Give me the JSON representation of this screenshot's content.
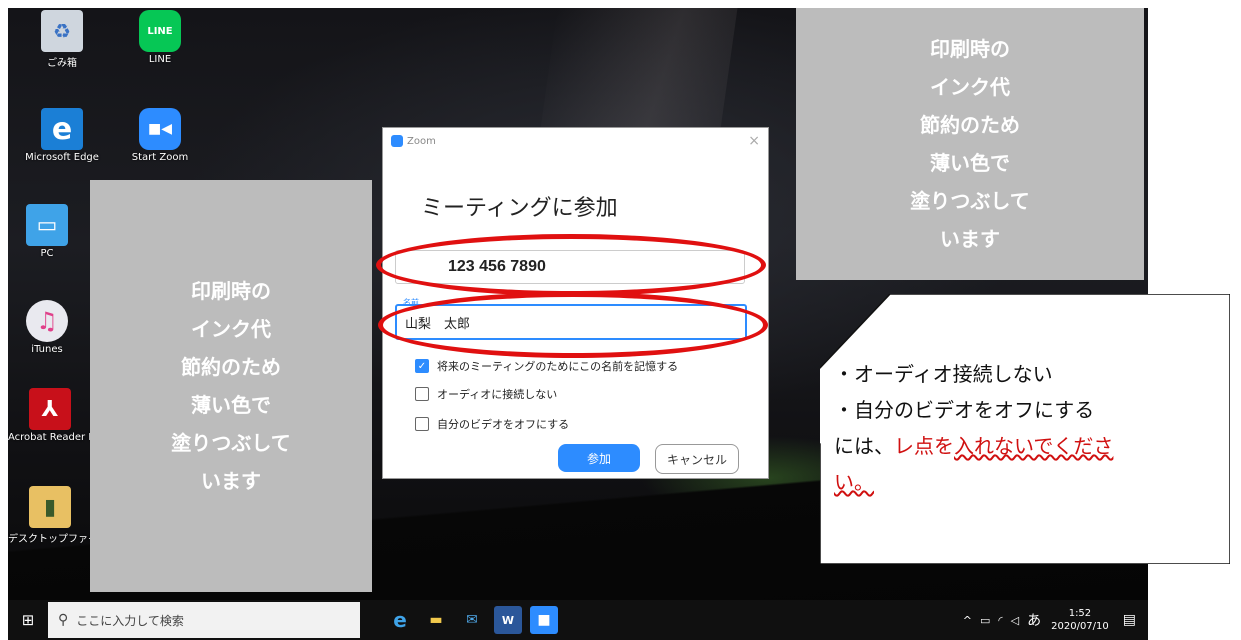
{
  "desktop": {
    "icons": [
      {
        "label": "ごみ箱"
      },
      {
        "label": "LINE",
        "glyph": "LINE"
      },
      {
        "label": "Microsoft Edge",
        "glyph": "e"
      },
      {
        "label": "Start Zoom",
        "glyph": "■◀"
      },
      {
        "label": "PC",
        "glyph": "▭"
      },
      {
        "label": "iTunes",
        "glyph": "♫"
      },
      {
        "label": "Acrobat Reader DC",
        "glyph": "⅄"
      },
      {
        "label": "デスクトップファイル",
        "glyph": "▮"
      }
    ]
  },
  "notes": {
    "left": [
      "印刷時の",
      "インク代",
      "節約のため",
      "薄い色で",
      "塗りつぶして",
      "います"
    ],
    "right": [
      "印刷時の",
      "インク代",
      "節約のため",
      "薄い色で",
      "塗りつぶして",
      "います"
    ]
  },
  "dialog": {
    "app_name": "Zoom",
    "close": "×",
    "title": "ミーティングに参加",
    "meeting_id_value": "123 456 7890",
    "name_label": "名前",
    "name_value": "山梨　太郎",
    "checkboxes": [
      {
        "label": "将来のミーティングのためにこの名前を記憶する",
        "checked": true
      },
      {
        "label": "オーディオに接続しない",
        "checked": false
      },
      {
        "label": "自分のビデオをオフにする",
        "checked": false
      }
    ],
    "join_label": "参加",
    "cancel_label": "キャンセル"
  },
  "callout": {
    "line1": "・オーディオ接続しない",
    "line2": "・自分のビデオをオフにする",
    "line3_prefix": "には、",
    "line3_red": "レ点を",
    "line3_wavy": "入れないでくださ",
    "line4": "い。"
  },
  "taskbar": {
    "search_placeholder": "ここに入力して検索",
    "tray_arrow": "^",
    "ime": "あ",
    "time": "1:52",
    "date": "2020/07/10"
  },
  "colors": {
    "zoom_blue": "#2d8cff",
    "annotation_red": "#e01010",
    "note_gray": "#bcbcbc"
  }
}
